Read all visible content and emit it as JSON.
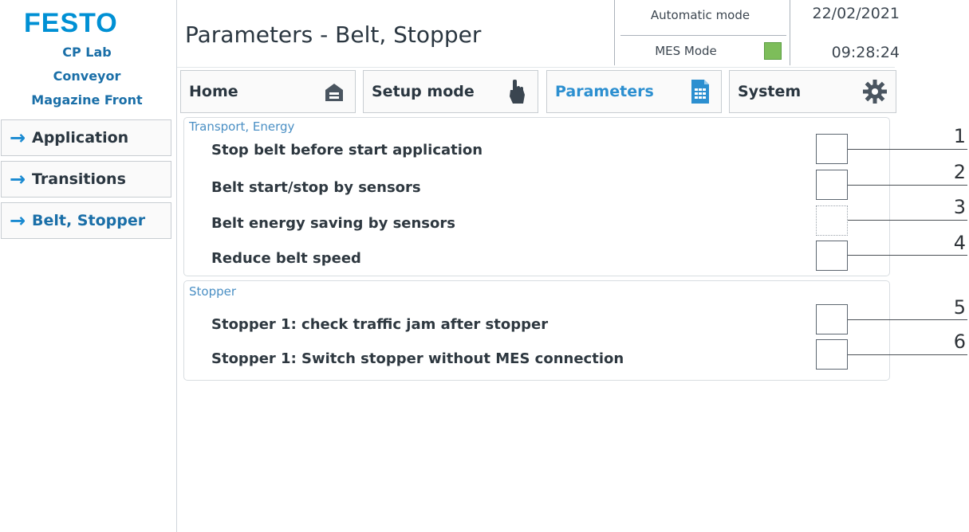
{
  "brand": {
    "logo": "FESTO"
  },
  "station": {
    "line1": "CP Lab",
    "line2": "Conveyor",
    "line3": "Magazine Front"
  },
  "header": {
    "title": "Parameters - Belt, Stopper",
    "automatic_mode": "Automatic mode",
    "mes_mode": "MES Mode",
    "mes_status_color": "#7dbd5a",
    "date": "22/02/2021",
    "time": "09:28:24"
  },
  "tabs": [
    {
      "label": "Home",
      "icon": "home-icon"
    },
    {
      "label": "Setup mode",
      "icon": "hand-pointer-icon"
    },
    {
      "label": "Parameters",
      "icon": "calculator-document-icon",
      "active": true
    },
    {
      "label": "System",
      "icon": "gear-icon"
    }
  ],
  "sidebar": {
    "items": [
      {
        "label": "Application"
      },
      {
        "label": "Transitions"
      },
      {
        "label": "Belt, Stopper",
        "active": true
      }
    ]
  },
  "groups": [
    {
      "title": "Transport, Energy",
      "params": [
        {
          "label": "Stop belt before start application",
          "checked": false,
          "callout": "1"
        },
        {
          "label": "Belt start/stop by sensors",
          "checked": false,
          "callout": "2"
        },
        {
          "label": "Belt energy saving by sensors",
          "checked": false,
          "callout": "3",
          "disabled": true
        },
        {
          "label": "Reduce belt speed",
          "checked": false,
          "callout": "4"
        }
      ]
    },
    {
      "title": "Stopper",
      "params": [
        {
          "label": "Stopper 1: check traffic jam after stopper",
          "checked": false,
          "callout": "5"
        },
        {
          "label": "Stopper 1: Switch stopper without MES connection",
          "checked": false,
          "callout": "6"
        }
      ]
    }
  ],
  "colors": {
    "accent": "#1a8ad1",
    "brand": "#0090d4",
    "label": "#2e3840"
  }
}
